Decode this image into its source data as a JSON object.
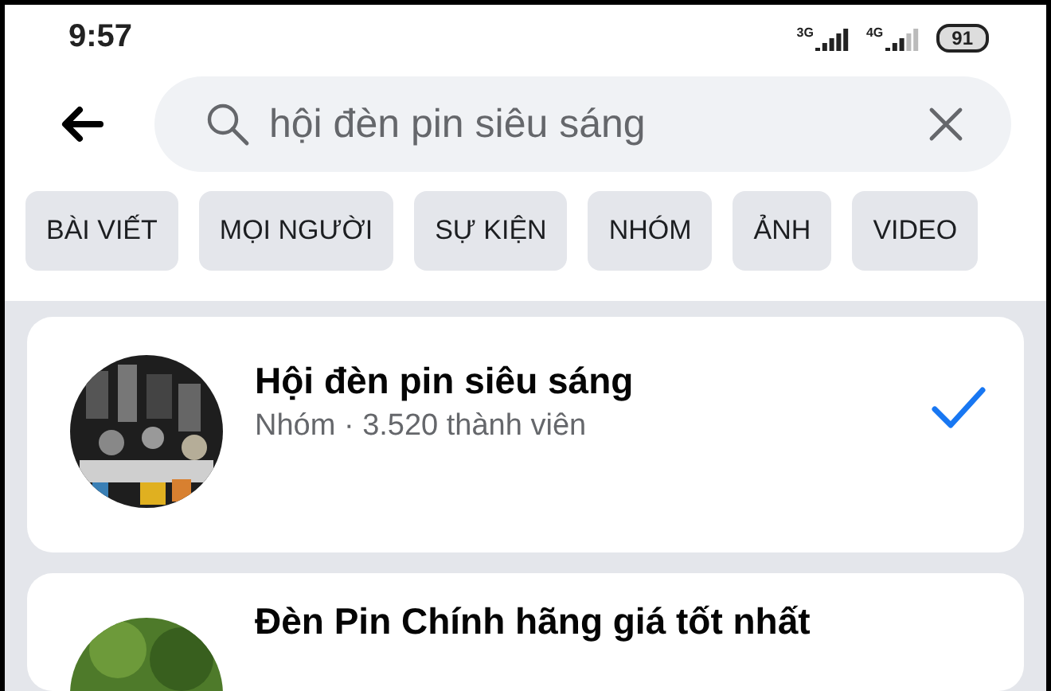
{
  "status_bar": {
    "time": "9:57",
    "networks": [
      {
        "label": "3G"
      },
      {
        "label": "4G"
      }
    ],
    "battery": "91"
  },
  "search": {
    "value": "hội đèn pin siêu sáng"
  },
  "filters": [
    {
      "label": "BÀI VIẾT"
    },
    {
      "label": "MỌI NGƯỜI"
    },
    {
      "label": "SỰ KIỆN"
    },
    {
      "label": "NHÓM"
    },
    {
      "label": "ẢNH"
    },
    {
      "label": "VIDEO"
    }
  ],
  "results": [
    {
      "title": "Hội đèn pin siêu sáng",
      "subtitle": "Nhóm · 3.520 thành viên",
      "selected": true
    },
    {
      "title": "Đèn Pin Chính hãng giá tốt nhất",
      "selected": false
    }
  ]
}
